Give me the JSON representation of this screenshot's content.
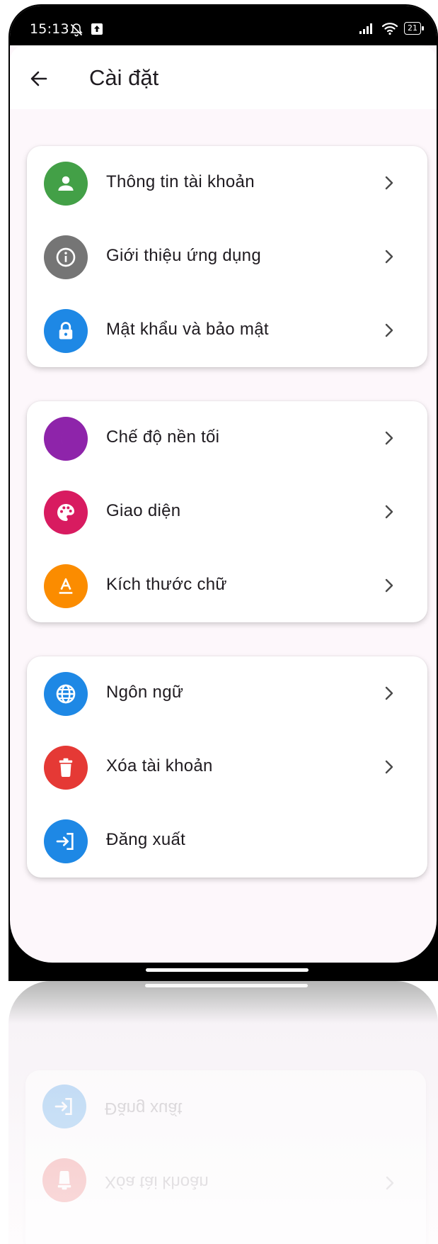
{
  "status_bar": {
    "time": "15:13",
    "battery": "21"
  },
  "app_bar": {
    "title": "Cài đặt"
  },
  "colors": {
    "account": "#43a047",
    "about": "#757575",
    "security": "#1e88e5",
    "dark_mode": "#8e24aa",
    "theme": "#d81b60",
    "font_size": "#fb8c00",
    "language": "#1e88e5",
    "delete_account": "#e53935",
    "logout": "#1e88e5"
  },
  "groups": [
    {
      "items": [
        {
          "label": "Thông tin tài khoản",
          "icon": "person-icon"
        },
        {
          "label": "Giới thiệu ứng dụng",
          "icon": "info-icon"
        },
        {
          "label": "Mật khẩu và bảo mật",
          "icon": "lock-icon"
        }
      ]
    },
    {
      "items": [
        {
          "label": "Chế độ nền tối",
          "icon": "moon-icon"
        },
        {
          "label": "Giao diện",
          "icon": "palette-icon"
        },
        {
          "label": "Kích thước chữ",
          "icon": "text-size-icon"
        }
      ]
    },
    {
      "items": [
        {
          "label": "Ngôn ngữ",
          "icon": "globe-icon"
        },
        {
          "label": "Xóa tài khoản",
          "icon": "trash-icon"
        },
        {
          "label": "Đăng xuất",
          "icon": "logout-icon"
        }
      ]
    }
  ]
}
